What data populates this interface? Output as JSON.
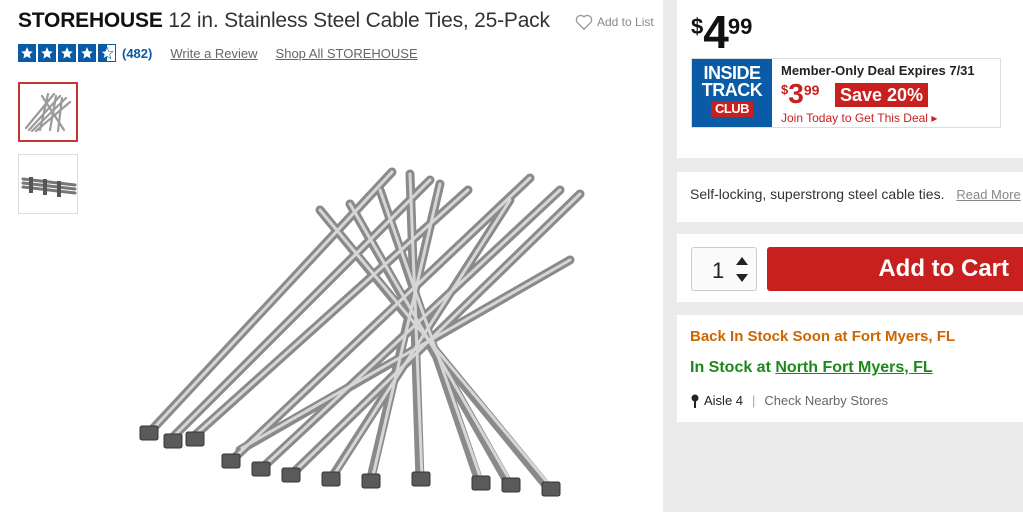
{
  "product": {
    "brand": "STOREHOUSE",
    "name": "12 in. Stainless Steel Cable Ties, 25-Pack",
    "add_to_list": "Add to List",
    "rating": 4.5,
    "review_count": "(482)",
    "write_review": "Write a Review",
    "shop_all": "Shop All STOREHOUSE"
  },
  "price": {
    "symbol": "$",
    "dollars": "4",
    "cents": "99"
  },
  "inside_track": {
    "logo_line1": "INSIDE",
    "logo_line2": "TRACK",
    "logo_line3": "CLUB",
    "headline": "Member-Only Deal Expires 7/31",
    "symbol": "$",
    "dollars": "3",
    "cents": "99",
    "save": "Save 20%",
    "join": "Join Today to Get This Deal"
  },
  "description": {
    "text": "Self-locking, superstrong steel cable ties.",
    "read_more": "Read More"
  },
  "cart": {
    "quantity": "1",
    "add_label": "Add to Cart"
  },
  "availability": {
    "back_in_stock": "Back In Stock Soon at Fort Myers, FL",
    "in_stock_prefix": "In Stock at",
    "store": "North Fort Myers, FL",
    "aisle": "Aisle 4",
    "check_nearby": "Check Nearby Stores"
  },
  "colors": {
    "brand_red": "#c8201e",
    "brand_blue": "#0a5ba5",
    "in_stock_green": "#1b8a1b",
    "back_stock_orange": "#cc6600"
  }
}
